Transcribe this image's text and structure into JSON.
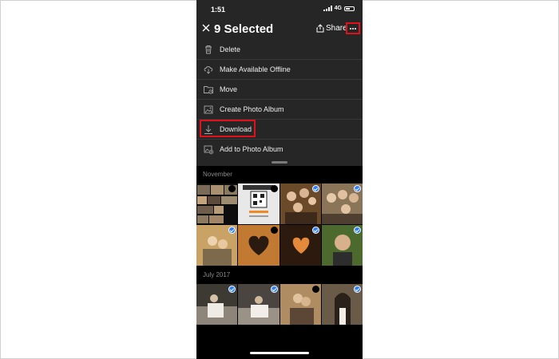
{
  "status_bar": {
    "time": "1:51",
    "network": "4G"
  },
  "header": {
    "title": "9 Selected",
    "share_label": "Share"
  },
  "menu": [
    {
      "label": "Delete",
      "icon": "trash-icon"
    },
    {
      "label": "Make Available Offline",
      "icon": "cloud-download-icon"
    },
    {
      "label": "Move",
      "icon": "folder-move-icon"
    },
    {
      "label": "Create Photo Album",
      "icon": "photo-album-icon"
    },
    {
      "label": "Download",
      "icon": "download-icon"
    },
    {
      "label": "Add to Photo Album",
      "icon": "add-photo-icon"
    }
  ],
  "sections": [
    {
      "label": "November"
    },
    {
      "label": "July 2017"
    }
  ],
  "colors": {
    "highlight": "#e0111a",
    "check": "#2d7ff9",
    "menu_bg": "#262626"
  }
}
